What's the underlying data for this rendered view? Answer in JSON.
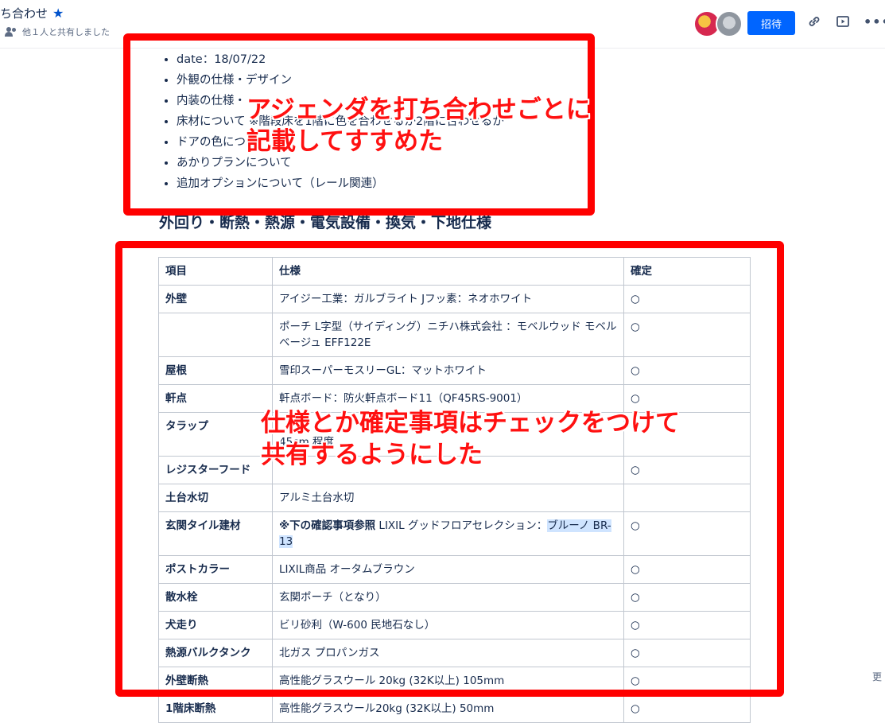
{
  "header": {
    "title": "ち合わせ",
    "shared_text": "他１人と共有しました",
    "invite_label": "招待"
  },
  "agenda": [
    "date：18/07/22",
    "外観の仕様・デザイン",
    "内装の仕様・",
    "床材について ※階段床を1階に色を合わせるか2階に合わせるか",
    "ドアの色につ",
    "あかりプランについて",
    "追加オプションについて（レール関連）"
  ],
  "section_heading": "外回り・断熱・熱源・電気設備・換気・下地仕様",
  "table": {
    "headers": [
      "項目",
      "仕様",
      "確定"
    ],
    "rows": [
      {
        "item": "外壁",
        "spec": "アイジー工業：ガルブライト Jフッ素：ネオホワイト",
        "confirmed": "○"
      },
      {
        "item": "",
        "spec": "ポーチ L字型（サイディング）ニチハ株式会社 ：モベルウッド モベルベージュ EFF122E",
        "confirmed": "○"
      },
      {
        "item": "屋根",
        "spec": "雪印スーパーモスリーGL：マットホワイト",
        "confirmed": "○"
      },
      {
        "item": "軒点",
        "spec": "軒点ボード：防火軒点ボード11（QF45RS-9001）",
        "confirmed": "○"
      },
      {
        "item": "タラップ",
        "spec": "45cm 程度",
        "confirmed": ""
      },
      {
        "item": "レジスターフード",
        "spec": "",
        "confirmed": "○"
      },
      {
        "item": "土台水切",
        "spec": "アルミ土台水切",
        "confirmed": ""
      },
      {
        "item": "玄関タイル建材",
        "spec_prefix": "※下の確認事項参照",
        "spec_main": " LIXIL グッドフロアセレクション：",
        "spec_highlight": "ブルーノ BR-13",
        "confirmed": "○"
      },
      {
        "item": "ポストカラー",
        "spec": "LIXIL商品 オータムブラウン",
        "confirmed": "○"
      },
      {
        "item": "散水栓",
        "spec": "玄関ポーチ（となり）",
        "confirmed": "○"
      },
      {
        "item": "犬走り",
        "spec": "ビリ砂利（W-600 民地石なし）",
        "confirmed": "○"
      },
      {
        "item": "熱源バルクタンク",
        "spec": "北ガス プロパンガス",
        "confirmed": "○"
      },
      {
        "item": "外壁断熱",
        "spec": "高性能グラスウール 20kg (32K以上) 105mm",
        "confirmed": "○"
      },
      {
        "item": "1階床断熱",
        "spec": "高性能グラスウール20kg (32K以上) 50mm",
        "confirmed": "○"
      }
    ]
  },
  "annotations": {
    "top_line1": "アジェンダを打ち合わせごとに",
    "top_line2": "記載してすすめた",
    "bottom_line1": "仕様とか確定事項はチェックをつけて",
    "bottom_line2": "共有するようにした"
  },
  "side_label": "更",
  "colors": {
    "annotation_red": "#ff0000",
    "invite_blue": "#0065ff",
    "star_blue": "#0052cc"
  }
}
